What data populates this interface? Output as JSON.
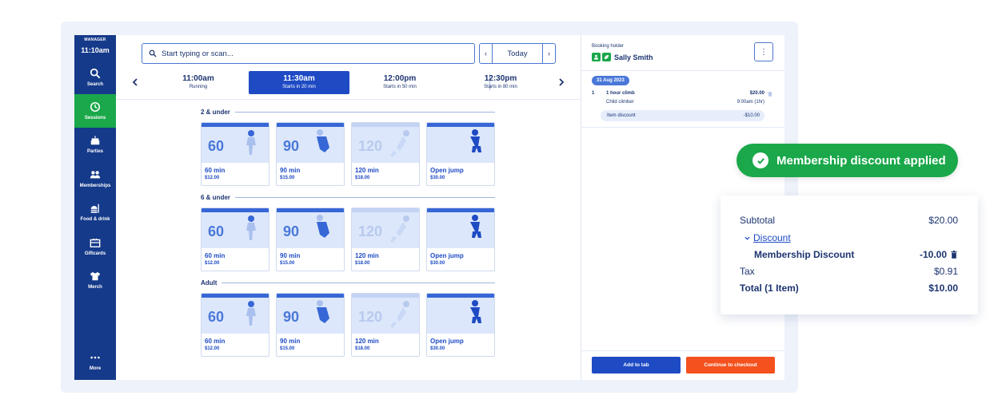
{
  "sidebar": {
    "role": "MANAGER",
    "time": "11:10am",
    "items": [
      {
        "label": "Search",
        "icon": "search-icon"
      },
      {
        "label": "Sessions",
        "icon": "clock-icon",
        "active": true
      },
      {
        "label": "Parties",
        "icon": "cake-icon"
      },
      {
        "label": "Memberships",
        "icon": "people-icon"
      },
      {
        "label": "Food & drink",
        "icon": "food-icon"
      },
      {
        "label": "Giftcards",
        "icon": "gift-icon"
      },
      {
        "label": "Merch",
        "icon": "tshirt-icon"
      },
      {
        "label": "More",
        "icon": "more-icon"
      }
    ]
  },
  "search": {
    "placeholder": "Start typing or scan..."
  },
  "date_picker": {
    "label": "Today",
    "prev": "‹",
    "next": "›"
  },
  "timeslots": [
    {
      "time": "11:00am",
      "status": "Running"
    },
    {
      "time": "11:30am",
      "status": "Starts in 20 min",
      "active": true
    },
    {
      "time": "12:00pm",
      "status": "Starts in 50 min"
    },
    {
      "time": "12:30pm",
      "status": "Starts in 80 min"
    }
  ],
  "sections": [
    {
      "title": "2 & under",
      "cards": [
        {
          "number": "60",
          "name": "60 min",
          "price": "$12.00"
        },
        {
          "number": "90",
          "name": "90 min",
          "price": "$15.00"
        },
        {
          "number": "120",
          "name": "120 min",
          "price": "$18.00"
        },
        {
          "number": "",
          "name": "Open jump",
          "price": "$30.00"
        }
      ]
    },
    {
      "title": "6 & under",
      "cards": [
        {
          "number": "60",
          "name": "60 min",
          "price": "$12.00"
        },
        {
          "number": "90",
          "name": "90 min",
          "price": "$15.00"
        },
        {
          "number": "120",
          "name": "120 min",
          "price": "$18.00"
        },
        {
          "number": "",
          "name": "Open jump",
          "price": "$30.00"
        }
      ]
    },
    {
      "title": "Adult",
      "cards": [
        {
          "number": "60",
          "name": "60 min",
          "price": "$12.00"
        },
        {
          "number": "90",
          "name": "90 min",
          "price": "$15.00"
        },
        {
          "number": "120",
          "name": "120 min",
          "price": "$18.00"
        },
        {
          "number": "",
          "name": "Open jump",
          "price": "$30.00"
        }
      ]
    }
  ],
  "booking": {
    "holder_label": "Booking holder",
    "holder_name": "Sally Smith",
    "date": "31 Aug 2023",
    "line_item": {
      "qty": "1",
      "name": "1 hour climb",
      "price": "$20.00",
      "sub_label": "Child climber",
      "sub_time": "9:00am (1hr)",
      "discount_label": "Item discount",
      "discount_value": "-$10.00"
    },
    "add_to_tab": "Add to tab",
    "checkout": "Continue to checkout"
  },
  "toast": {
    "message": "Membership discount applied"
  },
  "summary": {
    "subtotal_label": "Subtotal",
    "subtotal_value": "$20.00",
    "discount_label": "Discount",
    "membership_label": "Membership Discount",
    "membership_value": "-10.00",
    "tax_label": "Tax",
    "tax_value": "$0.91",
    "total_label": "Total (1 Item)",
    "total_value": "$10.00"
  },
  "colors": {
    "sidebar": "#153a8a",
    "primary": "#1e4bc4",
    "success": "#1aa84a",
    "checkout": "#f4511e"
  }
}
